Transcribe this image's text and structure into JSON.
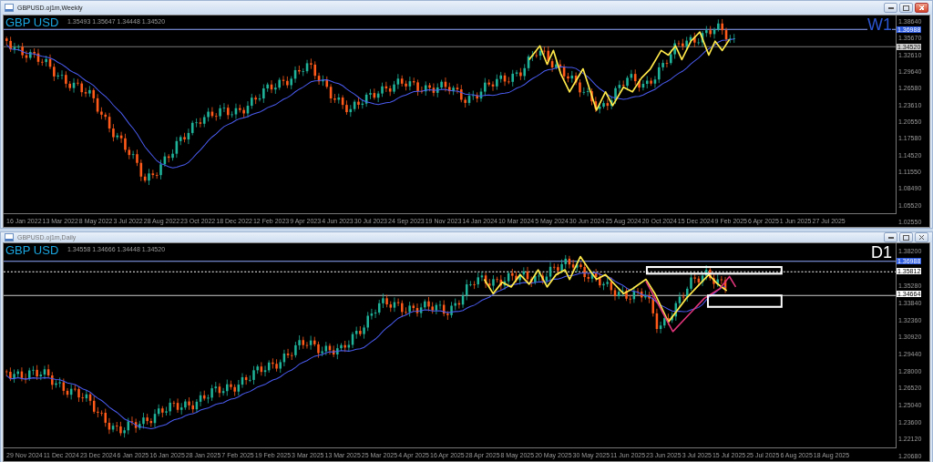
{
  "windows": [
    {
      "kind": "weekly",
      "active": true,
      "title": "GBPUSD.oj1m,Weekly",
      "symbol_label": "GBP USD",
      "ohlc": "1.35493 1.35647 1.34448 1.34520",
      "timeframe": "W1",
      "price_axis": {
        "labels": [
          "1.38640",
          "1.35670",
          "1.32610",
          "1.29640",
          "1.26580",
          "1.23610",
          "1.20550",
          "1.17580",
          "1.14520",
          "1.11550",
          "1.08490",
          "1.05520",
          "1.02550"
        ],
        "markers": [
          {
            "text": "1.36988",
            "kind": "line"
          },
          {
            "text": "1.34520",
            "kind": "bid"
          }
        ]
      },
      "date_axis": [
        "16 Jan 2022",
        "13 Mar 2022",
        "8 May 2022",
        "3 Jul 2022",
        "28 Aug 2022",
        "23 Oct 2022",
        "18 Dec 2022",
        "12 Feb 2023",
        "9 Apr 2023",
        "4 Jun 2023",
        "30 Jul 2023",
        "24 Sep 2023",
        "19 Nov 2023",
        "14 Jan 2024",
        "10 Mar 2024",
        "5 May 2024",
        "30 Jun 2024",
        "25 Aug 2024",
        "20 Oct 2024",
        "15 Dec 2024",
        "9 Feb 2025",
        "6 Apr 2025",
        "1 Jun 2025",
        "27 Jul 2025"
      ]
    },
    {
      "kind": "daily",
      "active": false,
      "title": "GBPUSD.oj1m,Daily",
      "symbol_label": "GBP USD",
      "ohlc": "1.34558 1.34666 1.34448 1.34520",
      "timeframe": "D1",
      "price_axis": {
        "labels": [
          "1.38200",
          "1.35280",
          "1.33840",
          "1.32360",
          "1.30920",
          "1.29440",
          "1.28000",
          "1.26520",
          "1.25040",
          "1.23600",
          "1.22120",
          "1.20680"
        ],
        "markers": [
          {
            "text": "1.36988",
            "kind": "line"
          },
          {
            "text": "1.35812",
            "kind": "level"
          },
          {
            "text": "1.34664",
            "kind": "level"
          }
        ]
      },
      "date_axis": [
        "29 Nov 2024",
        "11 Dec 2024",
        "23 Dec 2024",
        "6 Jan 2025",
        "16 Jan 2025",
        "28 Jan 2025",
        "7 Feb 2025",
        "19 Feb 2025",
        "3 Mar 2025",
        "13 Mar 2025",
        "25 Mar 2025",
        "4 Apr 2025",
        "16 Apr 2025",
        "28 Apr 2025",
        "8 May 2025",
        "20 May 2025",
        "30 May 2025",
        "11 Jun 2025",
        "23 Jun 2025",
        "3 Jul 2025",
        "15 Jul 2025",
        "25 Jul 2025",
        "6 Aug 2025",
        "18 Aug 2025"
      ]
    }
  ]
}
